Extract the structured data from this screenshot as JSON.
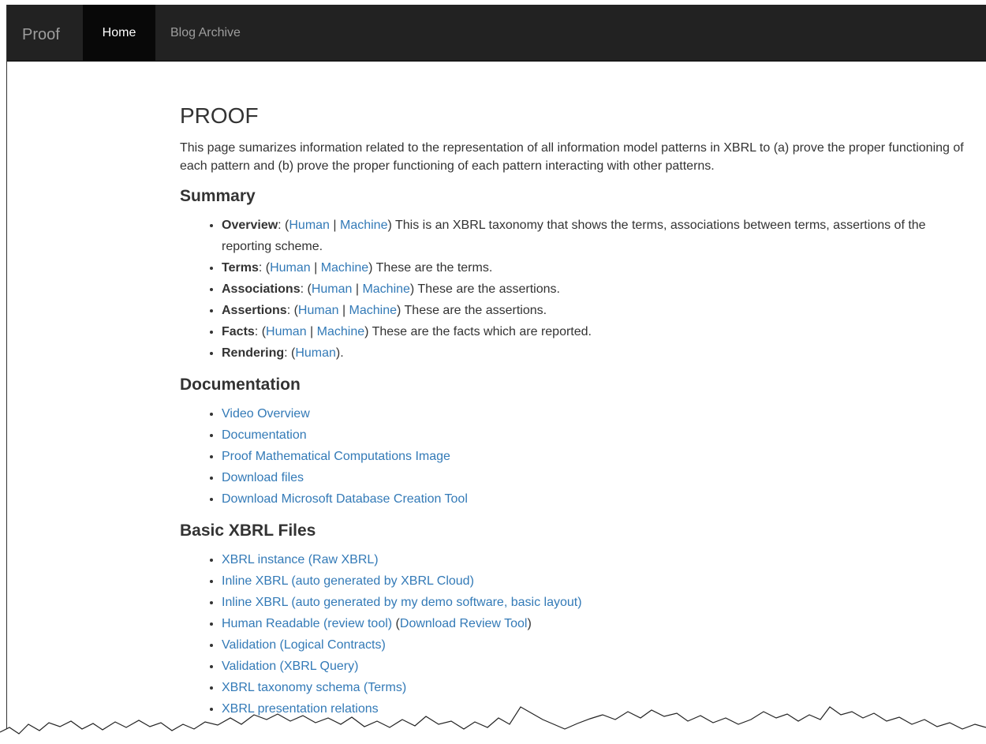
{
  "navbar": {
    "brand": "Proof",
    "items": [
      {
        "label": "Home"
      },
      {
        "label": "Blog Archive"
      }
    ]
  },
  "page": {
    "title": "PROOF",
    "intro": "This page sumarizes information related to the representation of all information model patterns in XBRL to (a) prove the proper functioning of each pattern and (b) prove the proper functioning of each pattern interacting with other patterns."
  },
  "summary": {
    "heading": "Summary",
    "items": [
      {
        "label": "Overview",
        "links": [
          "Human",
          "Machine"
        ],
        "desc": "This is an XBRL taxonomy that shows the terms, associations between terms, assertions of the reporting scheme."
      },
      {
        "label": "Terms",
        "links": [
          "Human",
          "Machine"
        ],
        "desc": "These are the terms."
      },
      {
        "label": "Associations",
        "links": [
          "Human",
          "Machine"
        ],
        "desc": "These are the assertions."
      },
      {
        "label": "Assertions",
        "links": [
          "Human",
          "Machine"
        ],
        "desc": "These are the assertions."
      },
      {
        "label": "Facts",
        "links": [
          "Human",
          "Machine"
        ],
        "desc": "These are the facts which are reported."
      },
      {
        "label": "Rendering",
        "links": [
          "Human"
        ],
        "desc": "."
      }
    ]
  },
  "documentation": {
    "heading": "Documentation",
    "links": [
      "Video Overview",
      "Documentation",
      "Proof Mathematical Computations Image",
      "Download files",
      "Download Microsoft Database Creation Tool"
    ]
  },
  "basic_files": {
    "heading": "Basic XBRL Files",
    "links": [
      "XBRL instance (Raw XBRL)",
      "Inline XBRL (auto generated by XBRL Cloud)",
      "Inline XBRL (auto generated by my demo software, basic layout)",
      "Human Readable (review tool)",
      "Download Review Tool",
      "Validation (Logical Contracts)",
      "Validation (XBRL Query)",
      "XBRL taxonomy schema (Terms)",
      "XBRL presentation relations"
    ]
  },
  "colors": {
    "navbar_bg": "#222222",
    "active_bg": "#080808",
    "link": "#337ab7",
    "text": "#333333"
  }
}
